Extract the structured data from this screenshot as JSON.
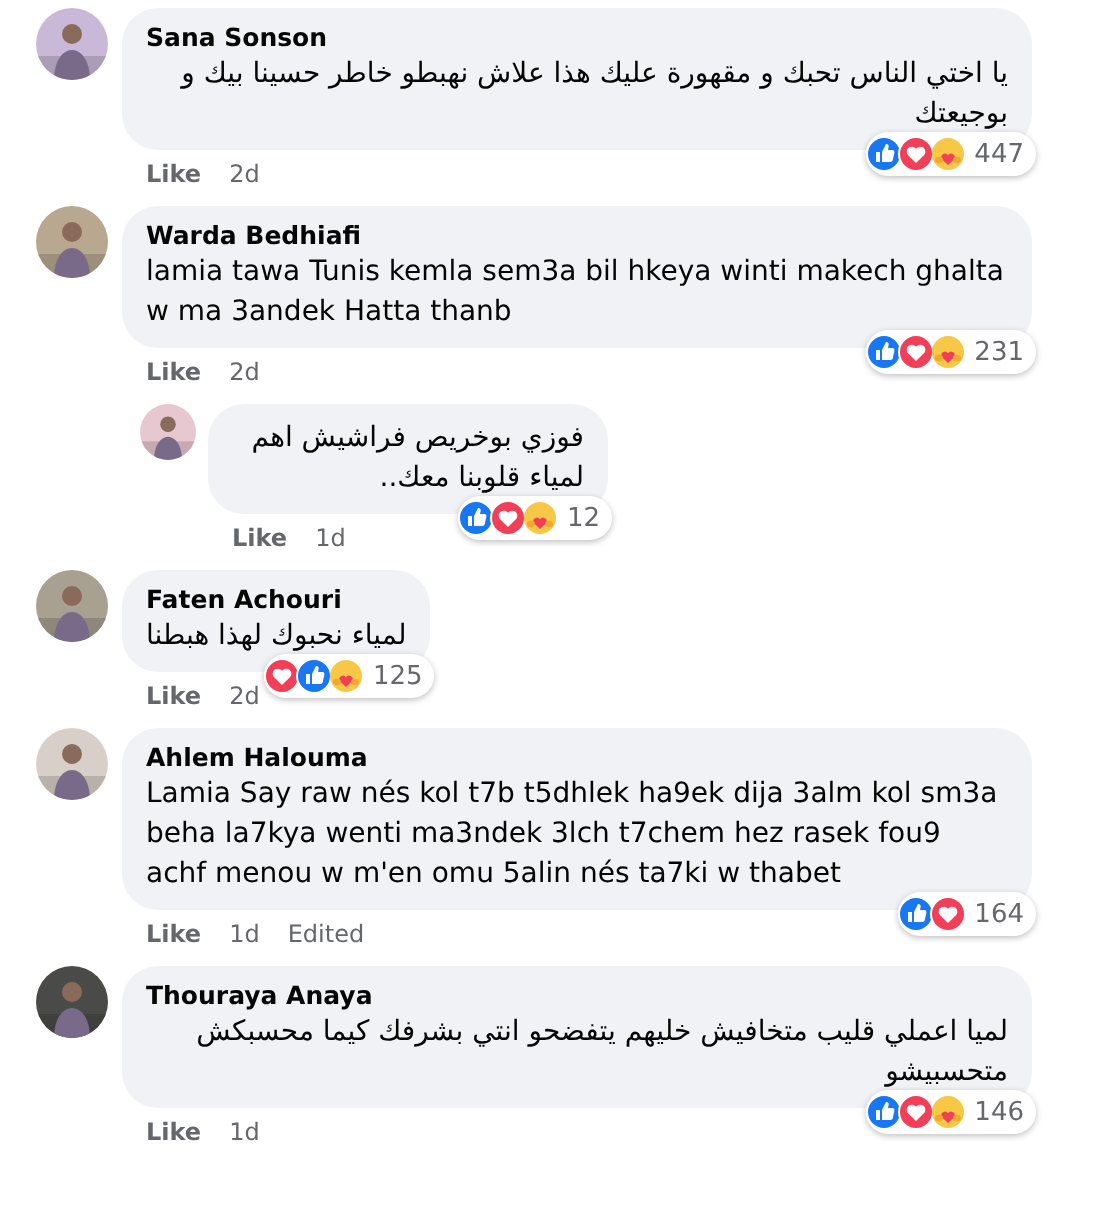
{
  "comments": [
    {
      "author": "Sana Sonson",
      "text": "يا اختي الناس تحبك و مقهورة عليك هذا علاش نهبطو خاطر حسينا بيك و بوجيعتك",
      "reactions": [
        {
          "kind": "like"
        },
        {
          "kind": "love"
        },
        {
          "kind": "care"
        }
      ],
      "count": "447",
      "like": "Like",
      "time": "2d"
    },
    {
      "author": "Warda Bedhiafi",
      "text": "lamia tawa Tunis kemla sem3a bil hkeya winti makech ghalta w ma 3andek Hatta thanb",
      "reactions": [
        {
          "kind": "like"
        },
        {
          "kind": "love"
        },
        {
          "kind": "care"
        }
      ],
      "count": "231",
      "like": "Like",
      "time": "2d",
      "children": [
        {
          "text": "فوزي بوخريص فراشيش اهم لمياء قلوبنا معك..",
          "reactions": [
            {
              "kind": "like"
            },
            {
              "kind": "love"
            },
            {
              "kind": "care"
            }
          ],
          "count": "12",
          "like": "Like",
          "time": "1d"
        }
      ]
    },
    {
      "author": "Faten Achouri",
      "text": "لمياء نحبوك لهذا هبطنا",
      "reactions": [
        {
          "kind": "love"
        },
        {
          "kind": "like"
        },
        {
          "kind": "care"
        }
      ],
      "count": "125",
      "like": "Like",
      "time": "2d"
    },
    {
      "author": "Ahlem Halouma",
      "text": "Lamia Say raw nés kol t7b t5dhlek ha9ek dija 3alm kol sm3a beha la7kya wenti ma3ndek 3lch t7chem hez rasek fou9 achf menou w m'en omu 5alin nés ta7ki w thabet",
      "reactions": [
        {
          "kind": "like"
        },
        {
          "kind": "love"
        }
      ],
      "count": "164",
      "like": "Like",
      "time": "1d",
      "edited": "Edited"
    },
    {
      "author": "Thouraya Anaya",
      "text": "لميا اعملي قليب متخافيش خليهم يتفضحو انتي بشرفك كيما محسبكش متحسبيشو",
      "reactions": [
        {
          "kind": "like"
        },
        {
          "kind": "love"
        },
        {
          "kind": "care"
        }
      ],
      "count": "146",
      "like": "Like",
      "time": "1d"
    }
  ]
}
